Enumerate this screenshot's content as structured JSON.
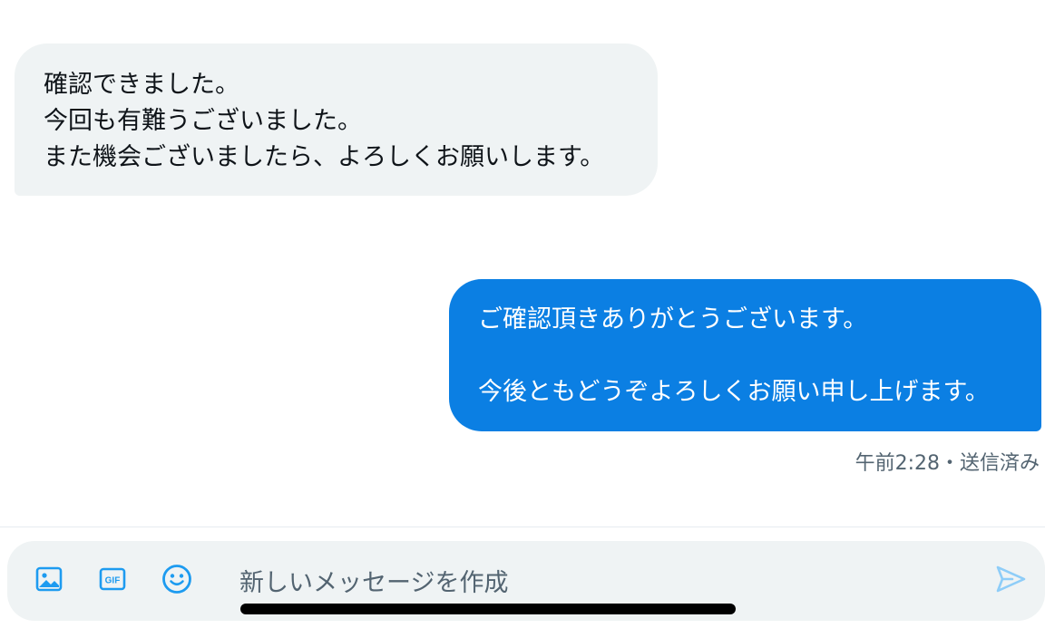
{
  "incoming_message": {
    "lines": [
      "確認できました。",
      "今回も有難うございました。",
      "また機会ございましたら、よろしくお願いします。"
    ]
  },
  "outgoing_message": {
    "lines": [
      "ご確認頂きありがとうございます。",
      "",
      "今後ともどうぞよろしくお願い申し上げます。"
    ],
    "meta": "午前2:28・送信済み"
  },
  "composer": {
    "placeholder": "新しいメッセージを作成",
    "icons": [
      "image-icon",
      "gif-icon",
      "emoji-icon",
      "send-icon"
    ]
  },
  "colors": {
    "incoming_bg": "#eff3f4",
    "outgoing_bg": "#0b7fe3",
    "accent": "#1d9bf0",
    "secondary_text": "#536471"
  }
}
